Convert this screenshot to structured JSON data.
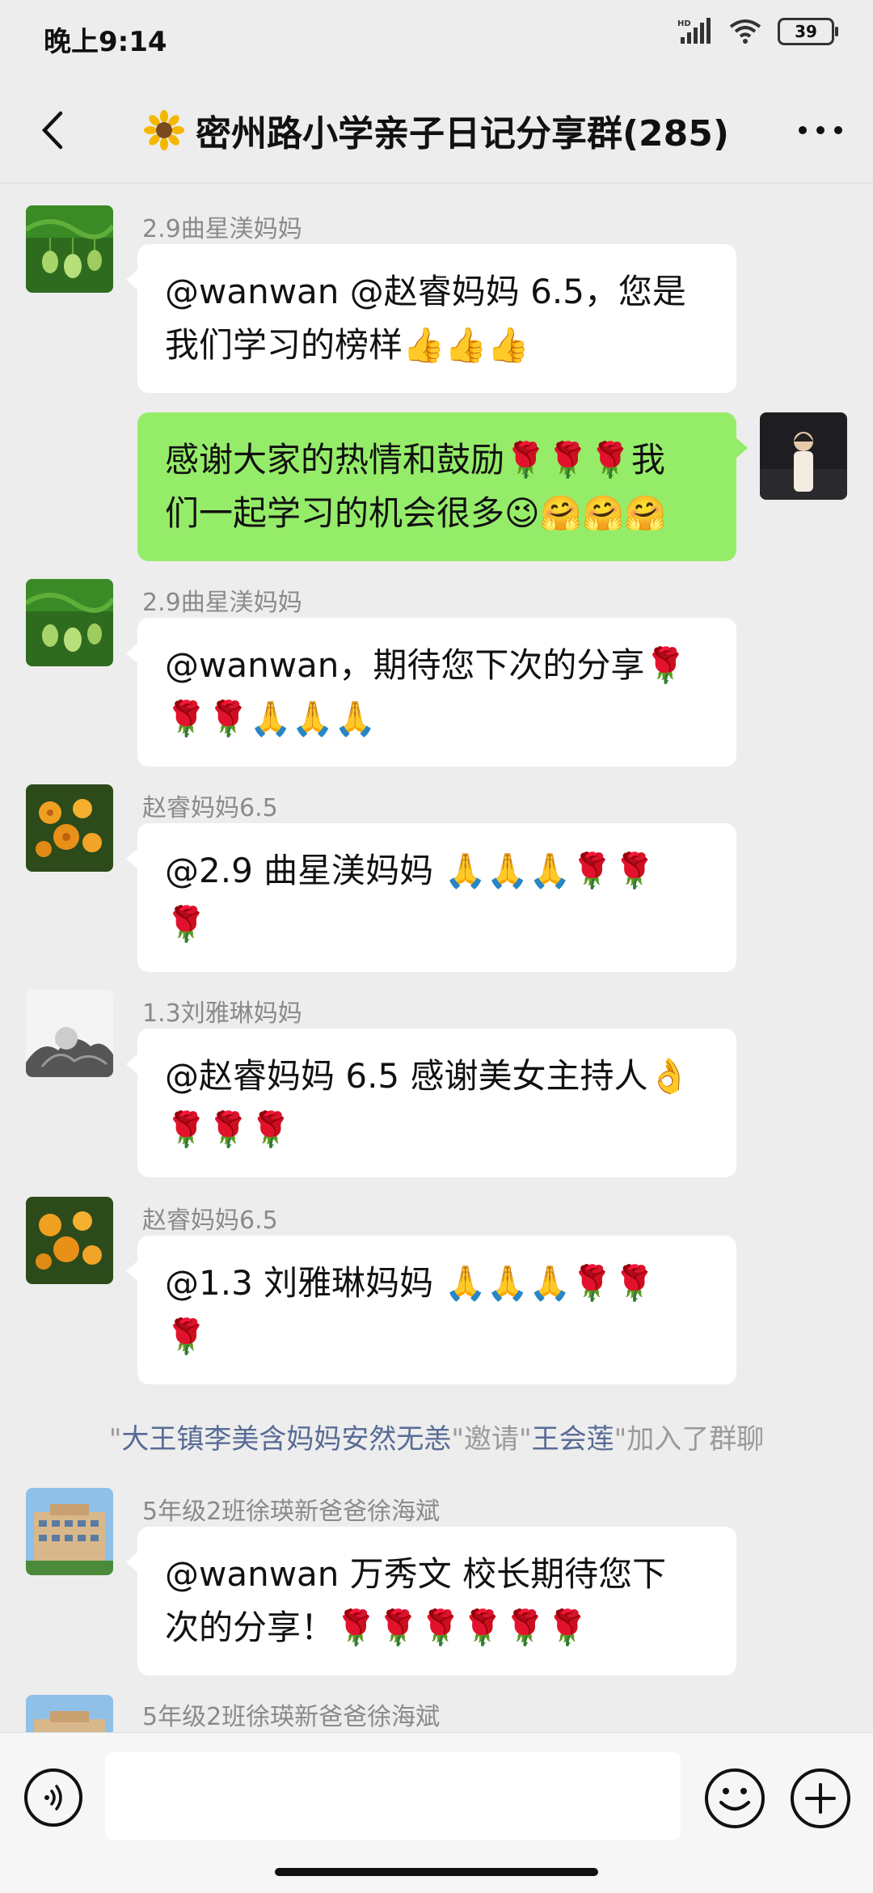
{
  "status": {
    "time": "晚上9:14",
    "battery": "39"
  },
  "header": {
    "title": "密州路小学亲子日记分享群(285)",
    "title_icon": "sunflower-emoji",
    "back_icon": "chevron-left-icon",
    "more_icon": "more-icon"
  },
  "messages": [
    {
      "sender": "2.9曲星渼妈妈",
      "lines": [
        "@wanwan @赵睿妈妈 6.5，您是",
        "我们学习的榜样👍👍👍"
      ],
      "self": false
    },
    {
      "sender": "",
      "lines": [
        "感谢大家的热情和鼓励🌹🌹🌹我",
        "们一起学习的机会很多😉🤗🤗🤗"
      ],
      "self": true
    },
    {
      "sender": "2.9曲星渼妈妈",
      "lines": [
        "@wanwan，期待您下次的分享🌹",
        "🌹🌹🙏🙏🙏"
      ],
      "self": false
    },
    {
      "sender": "赵睿妈妈6.5",
      "lines": [
        "@2.9 曲星渼妈妈  🙏🙏🙏🌹🌹",
        "🌹"
      ],
      "self": false
    },
    {
      "sender": "1.3刘雅琳妈妈",
      "lines": [
        "@赵睿妈妈 6.5  感谢美女主持人👌",
        "🌹🌹🌹"
      ],
      "self": false
    },
    {
      "sender": "赵睿妈妈6.5",
      "lines": [
        "@1.3 刘雅琳妈妈  🙏🙏🙏🌹🌹",
        "🌹"
      ],
      "self": false
    },
    {
      "sender": "5年级2班徐瑛新爸爸徐海斌",
      "lines": [
        "@wanwan  万秀文  校长期待您下",
        "次的分享！🌹🌹🌹🌹🌹🌹"
      ],
      "self": false
    },
    {
      "sender": "5年级2班徐瑛新爸爸徐海斌",
      "lines": [],
      "self": false
    }
  ],
  "system_notice": {
    "q1": "\"",
    "inviter": "大王镇李美含妈妈安然无恙",
    "q2": "\"邀请\"",
    "invitee": "王会莲",
    "q3": "\"加入了群聊"
  },
  "input": {
    "value": "",
    "voice_icon": "voice-icon",
    "emoji_icon": "emoji-icon",
    "plus_icon": "plus-icon"
  },
  "colors": {
    "background": "#ededed",
    "self_bubble": "#95ec69",
    "other_bubble": "#ffffff",
    "link_name": "#576b95"
  }
}
